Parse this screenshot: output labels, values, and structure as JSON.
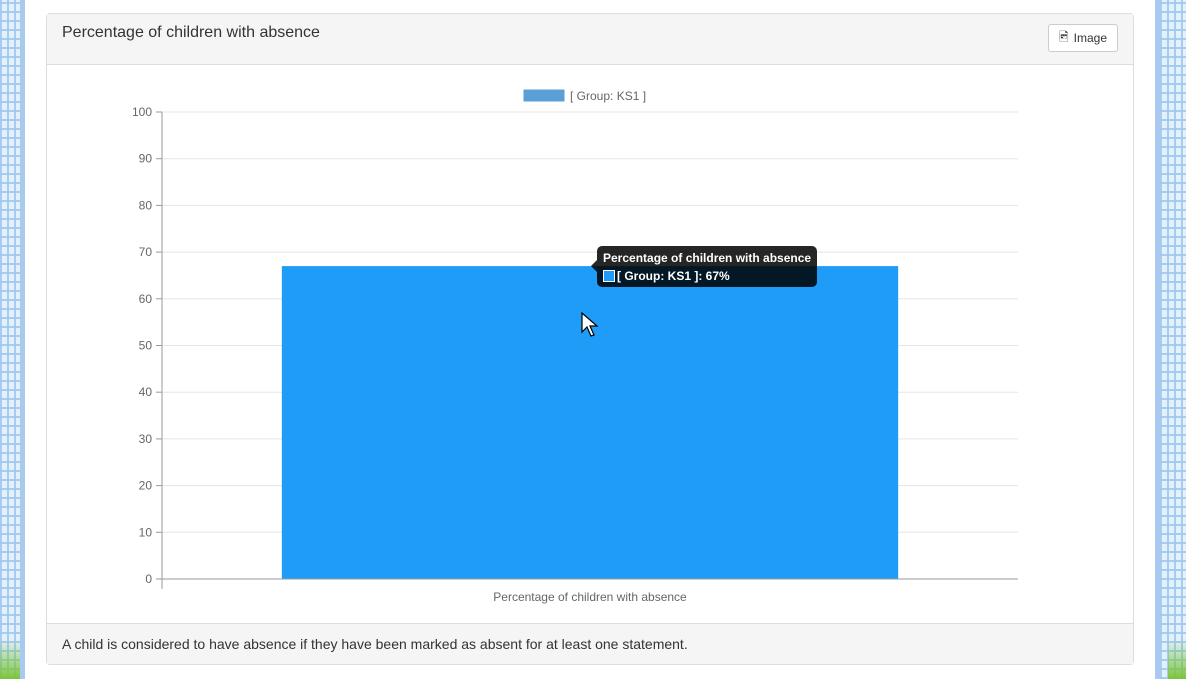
{
  "panel": {
    "title": "Percentage of children with absence",
    "image_button": "Image",
    "footer": "A child is considered to have absence if they have been marked as absent for at least one statement."
  },
  "tooltip": {
    "title": "Percentage of children with absence",
    "line": "[ Group: KS1 ]: 67%"
  },
  "colors": {
    "bar": "#1e9cf8",
    "legend": "#5a9fd8"
  },
  "chart_data": {
    "type": "bar",
    "categories": [
      "Percentage of children with absence"
    ],
    "series": [
      {
        "name": "[ Group: KS1 ]",
        "values": [
          67
        ]
      }
    ],
    "ylim": [
      0,
      100
    ],
    "yticks": [
      "0",
      "10",
      "20",
      "30",
      "40",
      "50",
      "60",
      "70",
      "80",
      "90",
      "100"
    ],
    "legend": "top",
    "grid": true
  }
}
